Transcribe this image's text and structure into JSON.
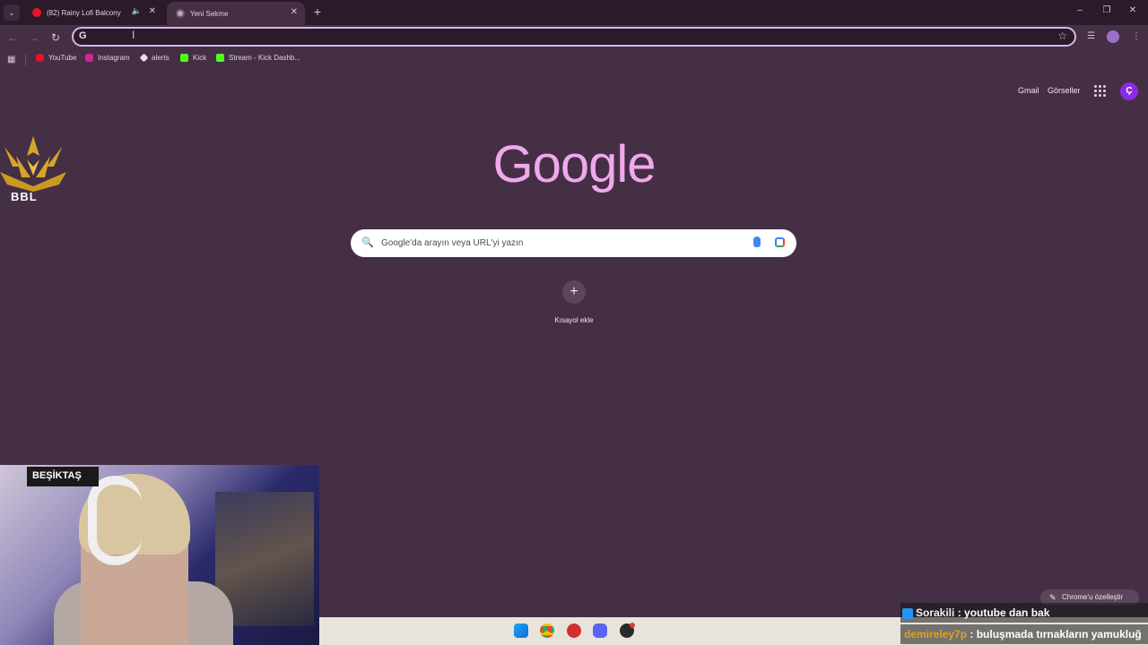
{
  "browser": {
    "tabs": [
      {
        "label": "(82) Rainy Lofi Balcony",
        "icon": "youtube-icon"
      },
      {
        "label": "Yeni Sekme",
        "icon": "chrome-icon"
      }
    ],
    "omnibox": {
      "value": "",
      "icon": "google-g-icon"
    },
    "bookmarks": [
      {
        "label": "YouTube",
        "icon": "youtube-icon"
      },
      {
        "label": "Instagram",
        "icon": "instagram-icon"
      },
      {
        "label": "alerts",
        "icon": "diamond-icon"
      },
      {
        "label": "Kick",
        "icon": "kick-icon"
      },
      {
        "label": "Stream - Kick Dashb...",
        "icon": "kick-icon"
      }
    ]
  },
  "ntp": {
    "links": {
      "gmail": "Gmail",
      "images": "Görseller"
    },
    "avatar_initial": "Ç",
    "logo": "Google",
    "search_placeholder": "Google'da arayın veya URL'yi yazın",
    "shortcut_label": "Kısayol ekle",
    "customize_label": "Chrome'u özelleştir"
  },
  "overlay": {
    "brand_text": "BBL",
    "webcam_poster": "BEŞİKTAŞ",
    "chat": [
      {
        "user": "Sorakili",
        "message": " : youtube dan bak"
      },
      {
        "user": "demireley7p",
        "message": " : buluşmada tırnakların yamukluğ"
      }
    ]
  },
  "colors": {
    "accent": "#d8b6e8",
    "logo": "#f0a8ec",
    "background": "#452f45",
    "tabstrip": "#2a1a2a"
  }
}
